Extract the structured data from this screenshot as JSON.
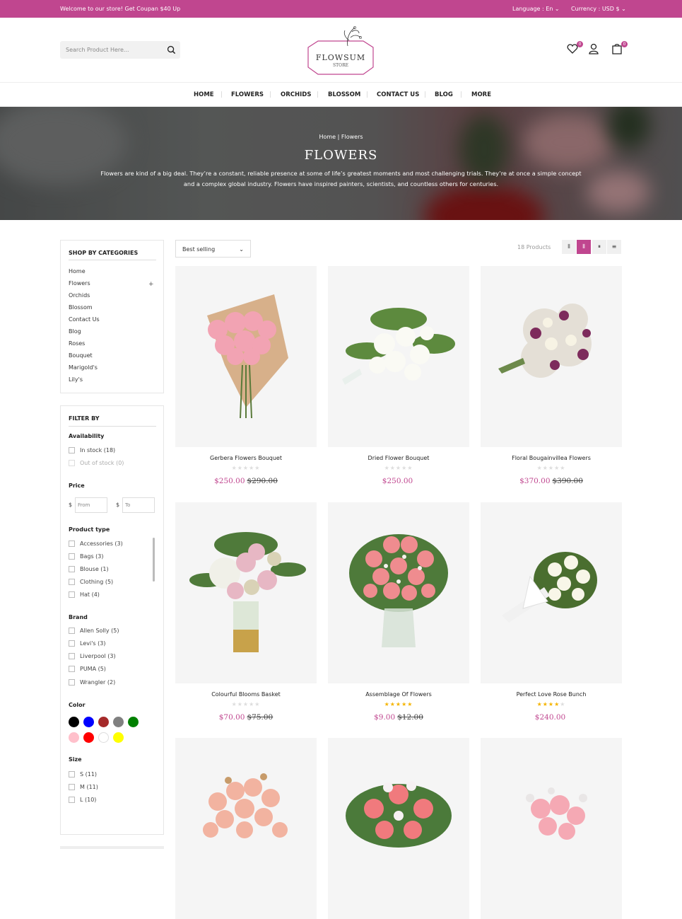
{
  "topbar": {
    "welcome": "Welcome to our store! Get Coupan $40 Up",
    "language": "Language : En ⌄",
    "currency": "Currency : USD $ ⌄"
  },
  "header": {
    "search_placeholder": "Search Product Here...",
    "logo_name": "FLOWSUM",
    "logo_sub": "STORE",
    "wishlist_count": "0",
    "cart_count": "0"
  },
  "nav": [
    "HOME",
    "FLOWERS",
    "ORCHIDS",
    "BLOSSOM",
    "CONTACT US",
    "BLOG",
    "MORE"
  ],
  "hero": {
    "breadcrumb_home": "Home |",
    "breadcrumb_current": "Flowers",
    "title": "FLOWERS",
    "description": "Flowers are kind of a big deal. They’re a constant, reliable presence at some of life’s greatest moments and most challenging trials. They’re at once a simple concept and a complex global industry. Flowers have inspired painters, scientists, and countless others for centuries."
  },
  "categories": {
    "title": "SHOP BY CATEGORIES",
    "items": [
      "Home",
      "Flowers",
      "Orchids",
      "Blossom",
      "Contact Us",
      "Blog",
      "Roses",
      "Bouquet",
      "Marigold's",
      "Lily's"
    ]
  },
  "filter": {
    "title": "FILTER BY",
    "availability": {
      "label": "Availability",
      "options": [
        "In stock (18)",
        "Out of stock (0)"
      ]
    },
    "price": {
      "label": "Price",
      "currency": "$",
      "from_placeholder": "From",
      "to_placeholder": "To"
    },
    "product_type": {
      "label": "Product type",
      "options": [
        "Accessories (3)",
        "Bags (3)",
        "Blouse (1)",
        "Clothing (5)",
        "Hat (4)"
      ]
    },
    "brand": {
      "label": "Brand",
      "options": [
        "Allen Solly (5)",
        "Levi's (3)",
        "Liverpool (3)",
        "PUMA (5)",
        "Wrangler (2)"
      ]
    },
    "color": {
      "label": "Color",
      "swatches": [
        "#000000",
        "#0000ff",
        "#a52a2a",
        "#808080",
        "#008000",
        "#ffc0cb",
        "#ff0000",
        "#ffffff",
        "#ffff00"
      ]
    },
    "size": {
      "label": "Size",
      "options": [
        "S (11)",
        "M (11)",
        "L (10)"
      ]
    }
  },
  "toolbar": {
    "sort": "Best selling",
    "count": "18 Products",
    "views": [
      "⦀",
      "⦀",
      "⏸",
      "≡"
    ]
  },
  "products": [
    {
      "title": "Gerbera Flowers Bouquet",
      "price": "$250.00",
      "old": "$290.00",
      "rating": 0
    },
    {
      "title": "Dried Flower Bouquet",
      "price": "$250.00",
      "old": "",
      "rating": 0
    },
    {
      "title": "Floral Bougainvillea Flowers",
      "price": "$370.00",
      "old": "$390.00",
      "rating": 0
    },
    {
      "title": "Colourful Blooms Basket",
      "price": "$70.00",
      "old": "$75.00",
      "rating": 0
    },
    {
      "title": "Assemblage Of Flowers",
      "price": "$9.00",
      "old": "$12.00",
      "rating": 5
    },
    {
      "title": "Perfect Love Rose Bunch",
      "price": "$240.00",
      "old": "",
      "rating": 4
    },
    {
      "title": "",
      "price": "",
      "old": "",
      "rating": 0
    },
    {
      "title": "",
      "price": "",
      "old": "",
      "rating": 0
    },
    {
      "title": "",
      "price": "",
      "old": "",
      "rating": 0
    }
  ],
  "colors": {
    "accent": "#c0468f",
    "star": "#f5b400",
    "star_empty": "#dddddd"
  }
}
